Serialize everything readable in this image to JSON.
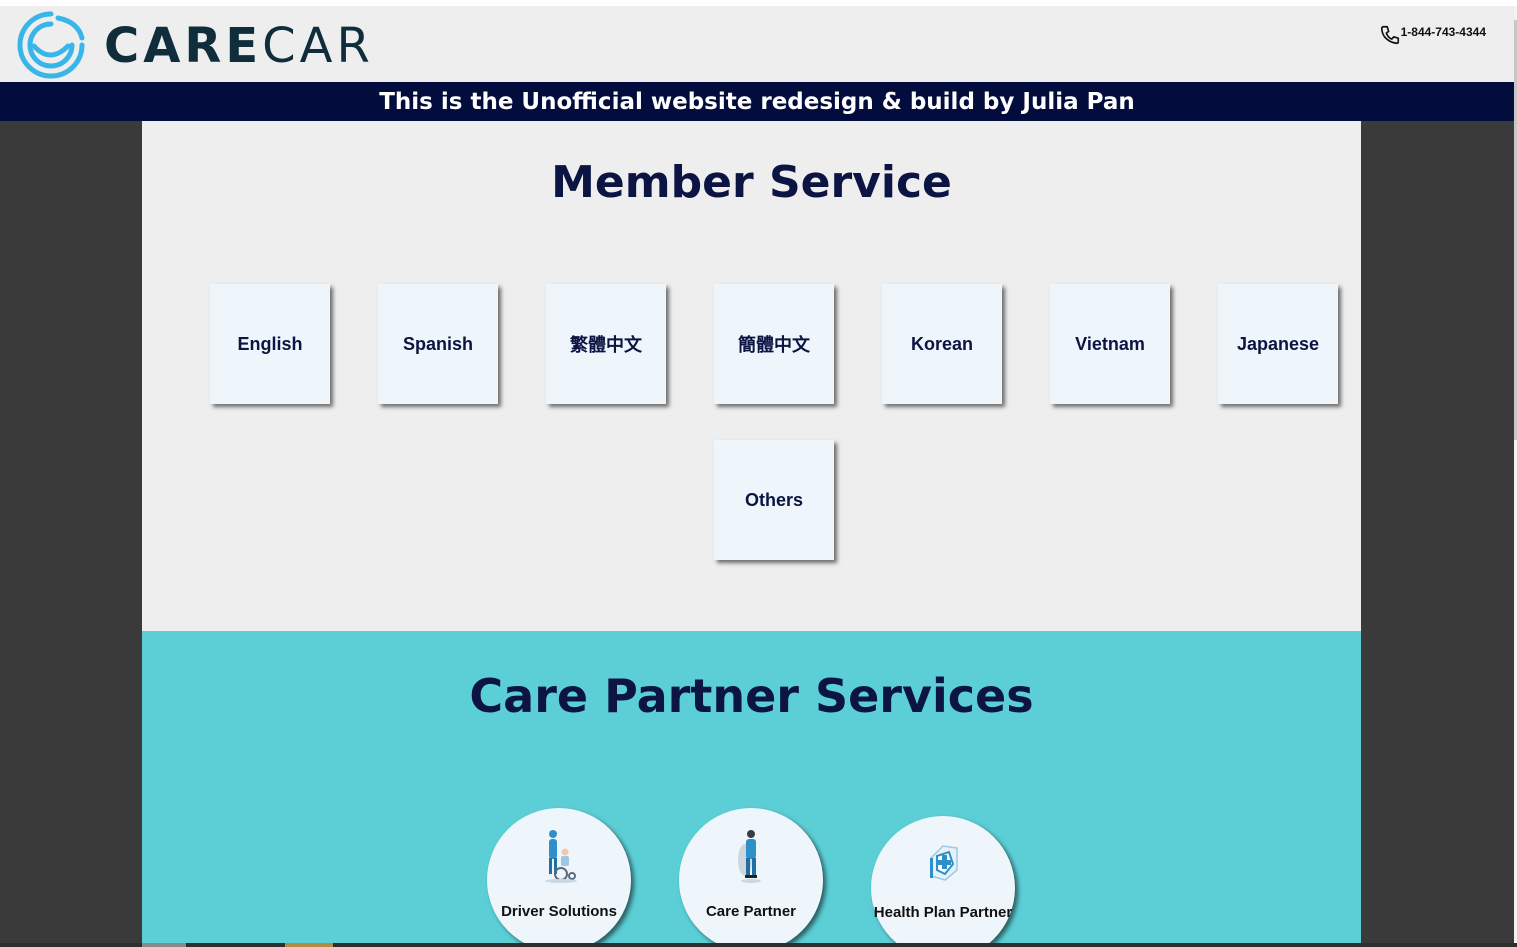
{
  "header": {
    "brand_part1": "CARE",
    "brand_part2": "CAR",
    "phone": "1-844-743-4344"
  },
  "banner": {
    "text": "This is the Unofficial website redesign & build by Julia Pan"
  },
  "member_service": {
    "title": "Member Service",
    "languages": [
      "English",
      "Spanish",
      "繁體中文",
      "簡體中文",
      "Korean",
      "Vietnam",
      "Japanese",
      "Others"
    ]
  },
  "care_partner": {
    "title": "Care Partner Services",
    "items": [
      {
        "label": "Driver Solutions",
        "icon": "wheelchair-driver-icon"
      },
      {
        "label": "Care Partner",
        "icon": "care-partner-person-icon"
      },
      {
        "label": "Health Plan Partner",
        "icon": "health-shield-icon"
      }
    ]
  },
  "colors": {
    "banner_bg": "#030d3d",
    "title_color": "#0b1442",
    "partners_bg": "#5ccfd6",
    "logo_blue": "#38b6e8"
  }
}
